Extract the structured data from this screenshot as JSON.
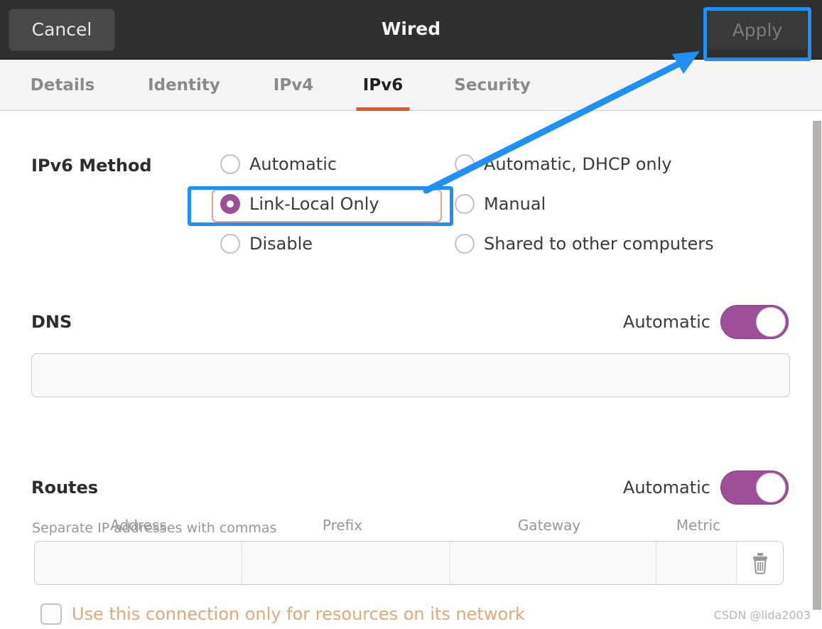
{
  "header": {
    "cancel_label": "Cancel",
    "title": "Wired",
    "apply_label": "Apply"
  },
  "tabs": [
    {
      "label": "Details",
      "active": false
    },
    {
      "label": "Identity",
      "active": false
    },
    {
      "label": "IPv4",
      "active": false
    },
    {
      "label": "IPv6",
      "active": true
    },
    {
      "label": "Security",
      "active": false
    }
  ],
  "ipv6_method": {
    "label": "IPv6 Method",
    "options": [
      {
        "label": "Automatic",
        "checked": false
      },
      {
        "label": "Link-Local Only",
        "checked": true
      },
      {
        "label": "Disable",
        "checked": false
      },
      {
        "label": "Automatic, DHCP only",
        "checked": false
      },
      {
        "label": "Manual",
        "checked": false
      },
      {
        "label": "Shared to other computers",
        "checked": false
      }
    ],
    "selected": "Link-Local Only"
  },
  "dns": {
    "label": "DNS",
    "toggle_label": "Automatic",
    "toggle_on": true,
    "value": "",
    "placeholder": "",
    "hint": "Separate IP addresses with commas"
  },
  "routes": {
    "label": "Routes",
    "toggle_label": "Automatic",
    "toggle_on": true,
    "columns": [
      "Address",
      "Prefix",
      "Gateway",
      "Metric"
    ],
    "rows": [
      {
        "address": "",
        "prefix": "",
        "gateway": "",
        "metric": ""
      }
    ],
    "delete_icon": "trash-icon"
  },
  "restrict_checkbox": {
    "label": "Use this connection only for resources on its network",
    "checked": false
  },
  "watermark": "CSDN @lida2003",
  "colors": {
    "headerbar_bg": "#2f2f2f",
    "tabbar_bg": "#f6f5f4",
    "active_tab_underline": "#e95420",
    "accent_purple": "#9c4f96",
    "annotation_blue": "#1e90f6",
    "focus_ring": "#f0a088",
    "checkbox_label": "#e0a97a"
  },
  "annotations": {
    "apply_highlight": "blue-rectangle-around-apply-button",
    "linklocal_highlight": "blue-rectangle-around-link-local-only",
    "arrow": "blue-arrow-from-link-local-only-to-apply-button"
  }
}
